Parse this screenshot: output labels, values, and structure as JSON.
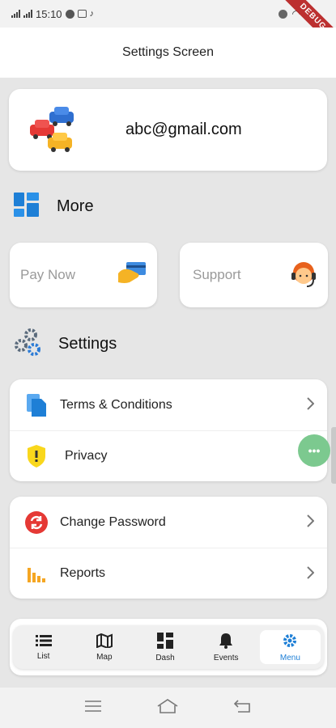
{
  "status_bar": {
    "time": "15:10",
    "debug_label": "DEBUG"
  },
  "app_bar": {
    "title": "Settings Screen"
  },
  "profile": {
    "email": "abc@gmail.com",
    "avatar_icon": "cars-icon"
  },
  "more": {
    "title": "More",
    "icon": "dashboard-grid-icon",
    "actions": [
      {
        "label": "Pay Now",
        "icon": "card-payment-icon"
      },
      {
        "label": "Support",
        "icon": "support-agent-icon"
      }
    ]
  },
  "settings": {
    "title": "Settings",
    "icon": "gears-icon",
    "group1": [
      {
        "label": "Terms & Conditions",
        "icon": "document-icon"
      },
      {
        "label": "Privacy",
        "icon": "shield-icon"
      }
    ],
    "group2": [
      {
        "label": "Change Password",
        "icon": "refresh-icon"
      },
      {
        "label": "Reports",
        "icon": "bar-chart-icon"
      }
    ]
  },
  "bottom_nav": {
    "items": [
      {
        "label": "List",
        "icon": "list-icon"
      },
      {
        "label": "Map",
        "icon": "map-icon"
      },
      {
        "label": "Dash",
        "icon": "dashboard-icon"
      },
      {
        "label": "Events",
        "icon": "bell-icon"
      },
      {
        "label": "Menu",
        "icon": "settings-gear-icon"
      }
    ],
    "active": "Menu"
  },
  "colors": {
    "accent": "#1e7fd6",
    "background": "#e6e6e6",
    "fab": "#7cc98f",
    "debug": "#b71c1c"
  }
}
